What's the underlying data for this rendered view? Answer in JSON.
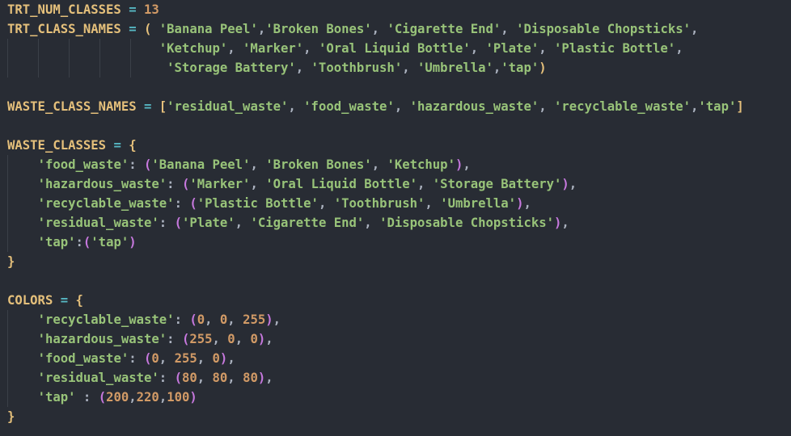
{
  "colors": {
    "background": "#282c34",
    "constant": "#e5c07b",
    "string": "#98c379",
    "number": "#d19a66",
    "operator": "#56b6c2",
    "punctuation": "#abb2bf",
    "bracket_level_1": "#e5c07b",
    "bracket_level_2": "#c678dd"
  },
  "code_lines": [
    [
      [
        "const",
        "TRT_NUM_CLASSES"
      ],
      [
        "plain",
        " "
      ],
      [
        "op",
        "="
      ],
      [
        "plain",
        " "
      ],
      [
        "num",
        "13"
      ]
    ],
    [
      [
        "const",
        "TRT_CLASS_NAMES"
      ],
      [
        "plain",
        " "
      ],
      [
        "op",
        "="
      ],
      [
        "plain",
        " "
      ],
      [
        "p1",
        "("
      ],
      [
        "plain",
        " "
      ],
      [
        "str",
        "'Banana Peel'"
      ],
      [
        "punc",
        ","
      ],
      [
        "str",
        "'Broken Bones'"
      ],
      [
        "punc",
        ", "
      ],
      [
        "str",
        "'Cigarette End'"
      ],
      [
        "punc",
        ", "
      ],
      [
        "str",
        "'Disposable Chopsticks'"
      ],
      [
        "punc",
        ","
      ]
    ],
    [
      [
        "plain",
        "                    "
      ],
      [
        "str",
        "'Ketchup'"
      ],
      [
        "punc",
        ", "
      ],
      [
        "str",
        "'Marker'"
      ],
      [
        "punc",
        ", "
      ],
      [
        "str",
        "'Oral Liquid Bottle'"
      ],
      [
        "punc",
        ", "
      ],
      [
        "str",
        "'Plate'"
      ],
      [
        "punc",
        ", "
      ],
      [
        "str",
        "'Plastic Bottle'"
      ],
      [
        "punc",
        ","
      ]
    ],
    [
      [
        "plain",
        "                     "
      ],
      [
        "str",
        "'Storage Battery'"
      ],
      [
        "punc",
        ", "
      ],
      [
        "str",
        "'Toothbrush'"
      ],
      [
        "punc",
        ", "
      ],
      [
        "str",
        "'Umbrella'"
      ],
      [
        "punc",
        ","
      ],
      [
        "str",
        "'tap'"
      ],
      [
        "p1",
        ")"
      ]
    ],
    [],
    [
      [
        "const",
        "WASTE_CLASS_NAMES"
      ],
      [
        "plain",
        " "
      ],
      [
        "op",
        "="
      ],
      [
        "plain",
        " "
      ],
      [
        "p1",
        "["
      ],
      [
        "str",
        "'residual_waste'"
      ],
      [
        "punc",
        ", "
      ],
      [
        "str",
        "'food_waste'"
      ],
      [
        "punc",
        ", "
      ],
      [
        "str",
        "'hazardous_waste'"
      ],
      [
        "punc",
        ", "
      ],
      [
        "str",
        "'recyclable_waste'"
      ],
      [
        "punc",
        ","
      ],
      [
        "str",
        "'tap'"
      ],
      [
        "p1",
        "]"
      ]
    ],
    [],
    [
      [
        "const",
        "WASTE_CLASSES"
      ],
      [
        "plain",
        " "
      ],
      [
        "op",
        "="
      ],
      [
        "plain",
        " "
      ],
      [
        "p1",
        "{"
      ]
    ],
    [
      [
        "plain",
        "    "
      ],
      [
        "str",
        "'food_waste'"
      ],
      [
        "punc",
        ": "
      ],
      [
        "p2",
        "("
      ],
      [
        "str",
        "'Banana Peel'"
      ],
      [
        "punc",
        ", "
      ],
      [
        "str",
        "'Broken Bones'"
      ],
      [
        "punc",
        ", "
      ],
      [
        "str",
        "'Ketchup'"
      ],
      [
        "p2",
        ")"
      ],
      [
        "punc",
        ","
      ]
    ],
    [
      [
        "plain",
        "    "
      ],
      [
        "str",
        "'hazardous_waste'"
      ],
      [
        "punc",
        ": "
      ],
      [
        "p2",
        "("
      ],
      [
        "str",
        "'Marker'"
      ],
      [
        "punc",
        ", "
      ],
      [
        "str",
        "'Oral Liquid Bottle'"
      ],
      [
        "punc",
        ", "
      ],
      [
        "str",
        "'Storage Battery'"
      ],
      [
        "p2",
        ")"
      ],
      [
        "punc",
        ","
      ]
    ],
    [
      [
        "plain",
        "    "
      ],
      [
        "str",
        "'recyclable_waste'"
      ],
      [
        "punc",
        ": "
      ],
      [
        "p2",
        "("
      ],
      [
        "str",
        "'Plastic Bottle'"
      ],
      [
        "punc",
        ", "
      ],
      [
        "str",
        "'Toothbrush'"
      ],
      [
        "punc",
        ", "
      ],
      [
        "str",
        "'Umbrella'"
      ],
      [
        "p2",
        ")"
      ],
      [
        "punc",
        ","
      ]
    ],
    [
      [
        "plain",
        "    "
      ],
      [
        "str",
        "'residual_waste'"
      ],
      [
        "punc",
        ": "
      ],
      [
        "p2",
        "("
      ],
      [
        "str",
        "'Plate'"
      ],
      [
        "punc",
        ", "
      ],
      [
        "str",
        "'Cigarette End'"
      ],
      [
        "punc",
        ", "
      ],
      [
        "str",
        "'Disposable Chopsticks'"
      ],
      [
        "p2",
        ")"
      ],
      [
        "punc",
        ","
      ]
    ],
    [
      [
        "plain",
        "    "
      ],
      [
        "str",
        "'tap'"
      ],
      [
        "punc",
        ":"
      ],
      [
        "p2",
        "("
      ],
      [
        "str",
        "'tap'"
      ],
      [
        "p2",
        ")"
      ]
    ],
    [
      [
        "p1",
        "}"
      ]
    ],
    [],
    [
      [
        "const",
        "COLORS"
      ],
      [
        "plain",
        " "
      ],
      [
        "op",
        "="
      ],
      [
        "plain",
        " "
      ],
      [
        "p1",
        "{"
      ]
    ],
    [
      [
        "plain",
        "    "
      ],
      [
        "str",
        "'recyclable_waste'"
      ],
      [
        "punc",
        ": "
      ],
      [
        "p2",
        "("
      ],
      [
        "num",
        "0"
      ],
      [
        "punc",
        ", "
      ],
      [
        "num",
        "0"
      ],
      [
        "punc",
        ", "
      ],
      [
        "num",
        "255"
      ],
      [
        "p2",
        ")"
      ],
      [
        "punc",
        ","
      ]
    ],
    [
      [
        "plain",
        "    "
      ],
      [
        "str",
        "'hazardous_waste'"
      ],
      [
        "punc",
        ": "
      ],
      [
        "p2",
        "("
      ],
      [
        "num",
        "255"
      ],
      [
        "punc",
        ", "
      ],
      [
        "num",
        "0"
      ],
      [
        "punc",
        ", "
      ],
      [
        "num",
        "0"
      ],
      [
        "p2",
        ")"
      ],
      [
        "punc",
        ","
      ]
    ],
    [
      [
        "plain",
        "    "
      ],
      [
        "str",
        "'food_waste'"
      ],
      [
        "punc",
        ": "
      ],
      [
        "p2",
        "("
      ],
      [
        "num",
        "0"
      ],
      [
        "punc",
        ", "
      ],
      [
        "num",
        "255"
      ],
      [
        "punc",
        ", "
      ],
      [
        "num",
        "0"
      ],
      [
        "p2",
        ")"
      ],
      [
        "punc",
        ","
      ]
    ],
    [
      [
        "plain",
        "    "
      ],
      [
        "str",
        "'residual_waste'"
      ],
      [
        "punc",
        ": "
      ],
      [
        "p2",
        "("
      ],
      [
        "num",
        "80"
      ],
      [
        "punc",
        ", "
      ],
      [
        "num",
        "80"
      ],
      [
        "punc",
        ", "
      ],
      [
        "num",
        "80"
      ],
      [
        "p2",
        ")"
      ],
      [
        "punc",
        ","
      ]
    ],
    [
      [
        "plain",
        "    "
      ],
      [
        "str",
        "'tap'"
      ],
      [
        "punc",
        " : "
      ],
      [
        "p2",
        "("
      ],
      [
        "num",
        "200"
      ],
      [
        "punc",
        ","
      ],
      [
        "num",
        "220"
      ],
      [
        "punc",
        ","
      ],
      [
        "num",
        "100"
      ],
      [
        "p2",
        ")"
      ]
    ],
    [
      [
        "p1",
        "}"
      ]
    ]
  ]
}
